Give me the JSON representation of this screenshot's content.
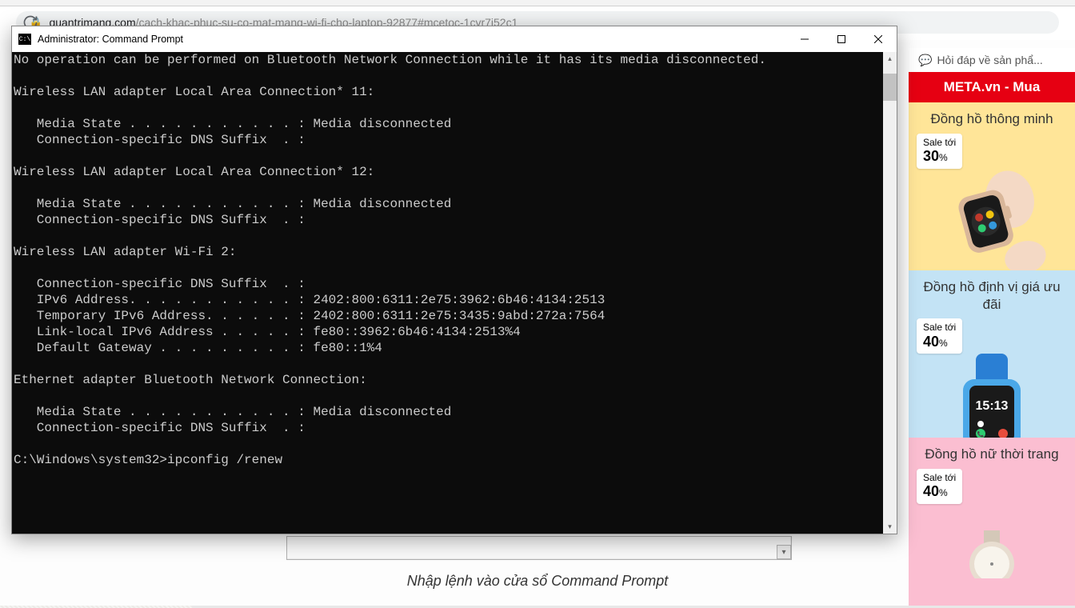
{
  "browser": {
    "url_domain": "quantrimang.com",
    "url_path": "/cach-khac-phuc-su-co-mat-mang-wi-fi-cho-laptop-92877#mcetoc-1cvr7i52c1"
  },
  "cmd": {
    "title": "Administrator: Command Prompt",
    "icon_text": "C:\\",
    "lines": [
      "No operation can be performed on Bluetooth Network Connection while it has its media disconnected.",
      "",
      "Wireless LAN adapter Local Area Connection* 11:",
      "",
      "   Media State . . . . . . . . . . . : Media disconnected",
      "   Connection-specific DNS Suffix  . :",
      "",
      "Wireless LAN adapter Local Area Connection* 12:",
      "",
      "   Media State . . . . . . . . . . . : Media disconnected",
      "   Connection-specific DNS Suffix  . :",
      "",
      "Wireless LAN adapter Wi-Fi 2:",
      "",
      "   Connection-specific DNS Suffix  . :",
      "   IPv6 Address. . . . . . . . . . . : 2402:800:6311:2e75:3962:6b46:4134:2513",
      "   Temporary IPv6 Address. . . . . . : 2402:800:6311:2e75:3435:9abd:272a:7564",
      "   Link-local IPv6 Address . . . . . : fe80::3962:6b46:4134:2513%4",
      "   Default Gateway . . . . . . . . . : fe80::1%4",
      "",
      "Ethernet adapter Bluetooth Network Connection:",
      "",
      "   Media State . . . . . . . . . . . : Media disconnected",
      "   Connection-specific DNS Suffix  . :",
      "",
      "C:\\Windows\\system32>ipconfig /renew"
    ]
  },
  "caption": "Nhập lệnh vào cửa sổ Command Prompt",
  "sidebar": {
    "faq": "Hỏi đáp về sản phẩ...",
    "banner": "META.vn - Mua",
    "ads": [
      {
        "title": "Đồng hồ thông minh",
        "sale_label": "Sale tới",
        "sale_pct": "30"
      },
      {
        "title": "Đồng hồ định vị giá ưu đãi",
        "sale_label": "Sale tới",
        "sale_pct": "40"
      },
      {
        "title": "Đồng hồ nữ thời trang",
        "sale_label": "Sale tới",
        "sale_pct": "40"
      }
    ]
  }
}
